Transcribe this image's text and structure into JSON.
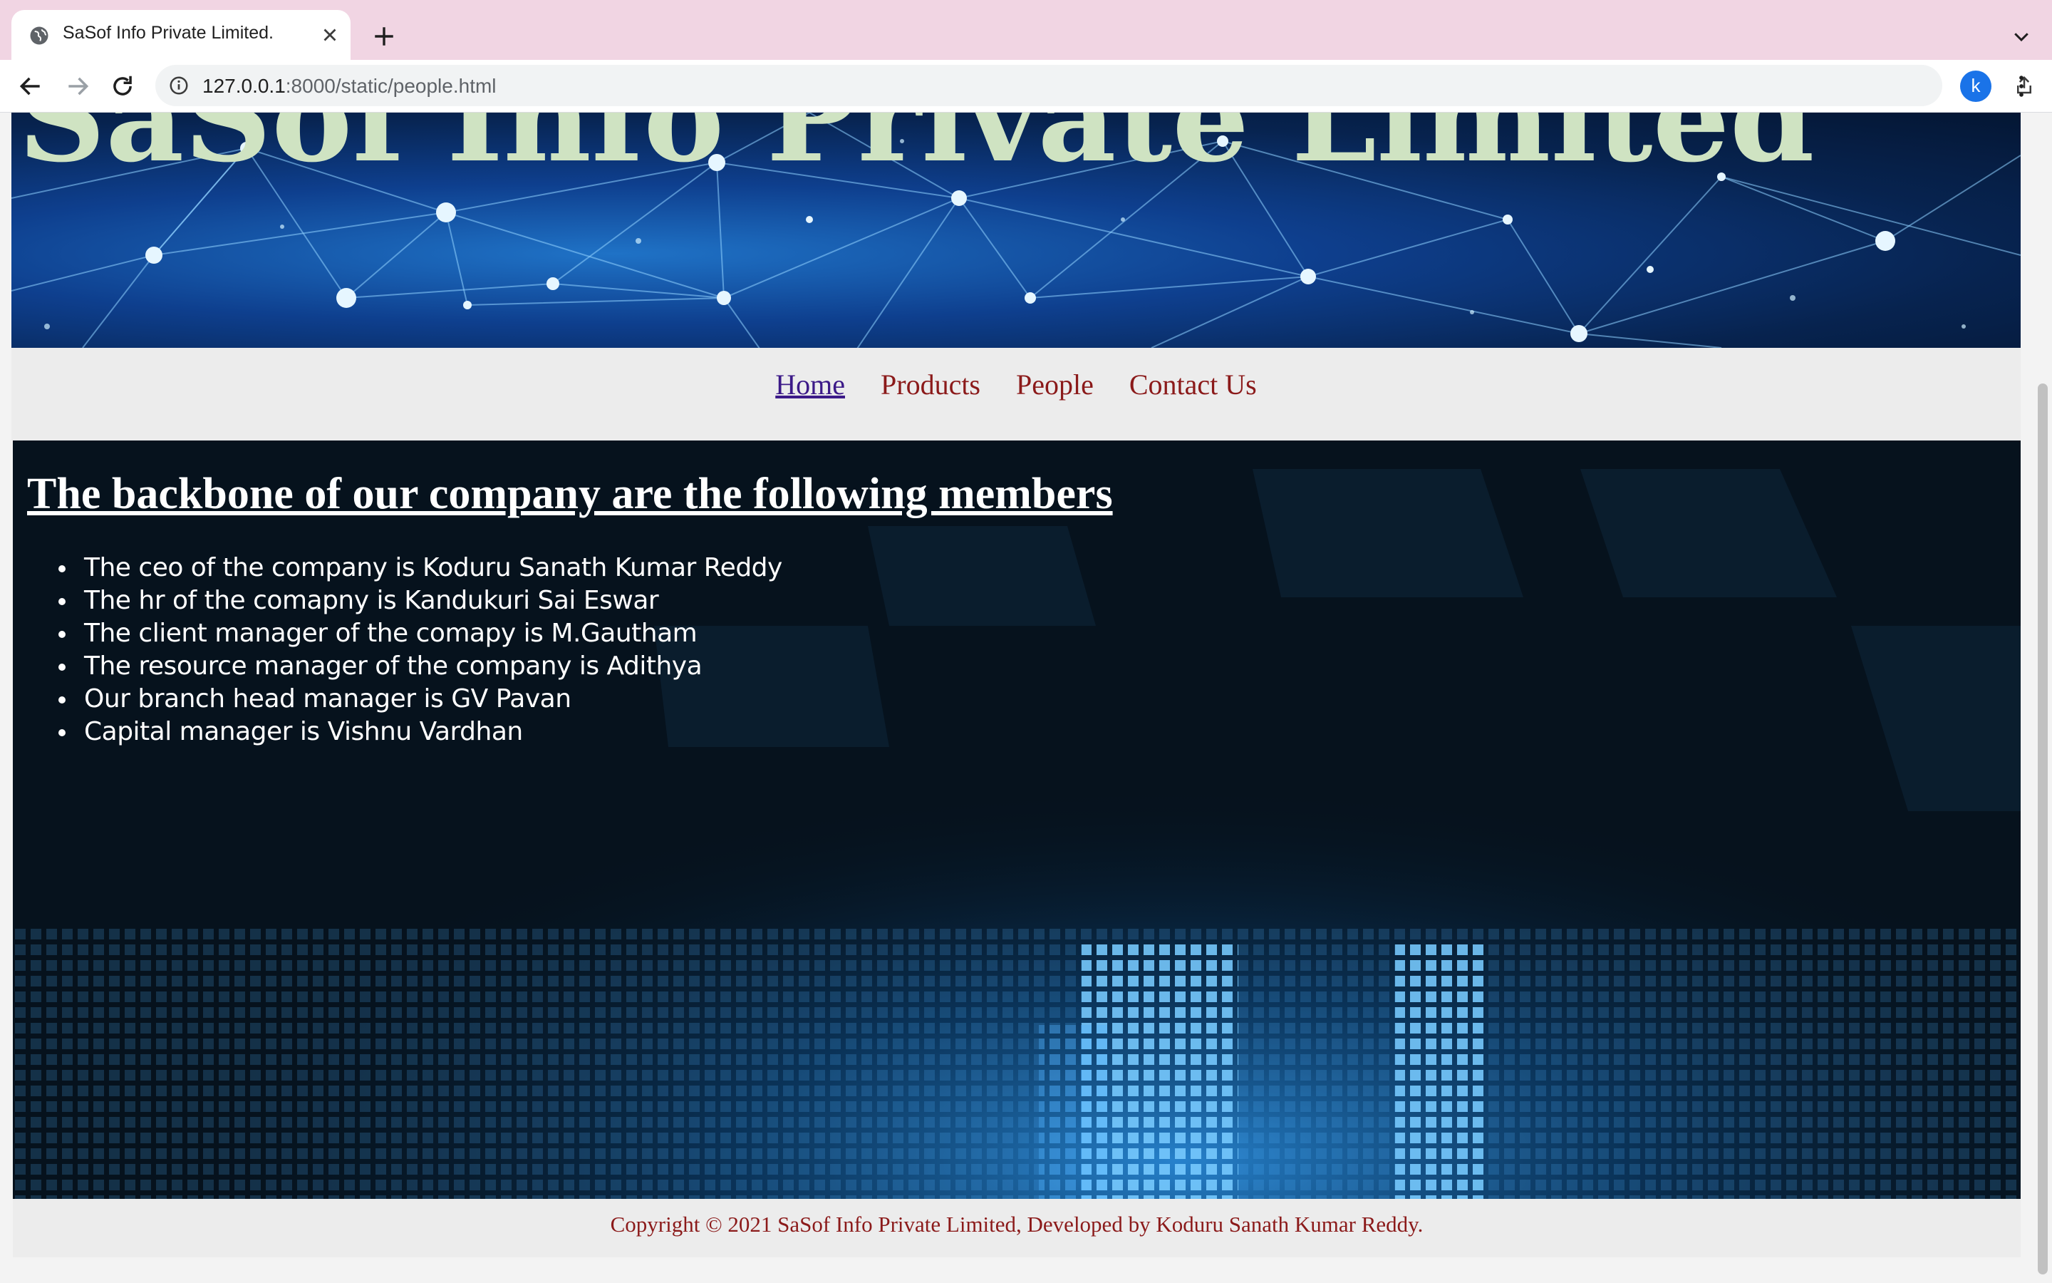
{
  "browser": {
    "tab_title": "SaSof Info Private Limited.",
    "url_host": "127.0.0.1",
    "url_rest": ":8000/static/people.html",
    "profile_initial": "k"
  },
  "banner": {
    "title": "SaSof Info Private Limited"
  },
  "nav": {
    "items": [
      {
        "label": "Home"
      },
      {
        "label": "Products"
      },
      {
        "label": "People"
      },
      {
        "label": "Contact Us"
      }
    ]
  },
  "main": {
    "heading": "The backbone of our company are the following members",
    "members": [
      "The ceo of the company is Koduru Sanath Kumar Reddy",
      "The hr of the comapny is Kandukuri Sai Eswar",
      "The client manager of the comapy is M.Gautham",
      "The resource manager of the company is Adithya",
      "Our branch head manager is GV Pavan",
      "Capital manager is Vishnu Vardhan"
    ]
  },
  "footer": {
    "text": "Copyright © 2021 SaSof Info Private Limited, Developed by Koduru Sanath Kumar Reddy."
  },
  "colors": {
    "nav_link": "#8b1a1a",
    "nav_link_visited": "#3c1a88",
    "tabstrip": "#f1d5e3",
    "content_bg": "#06121d"
  }
}
